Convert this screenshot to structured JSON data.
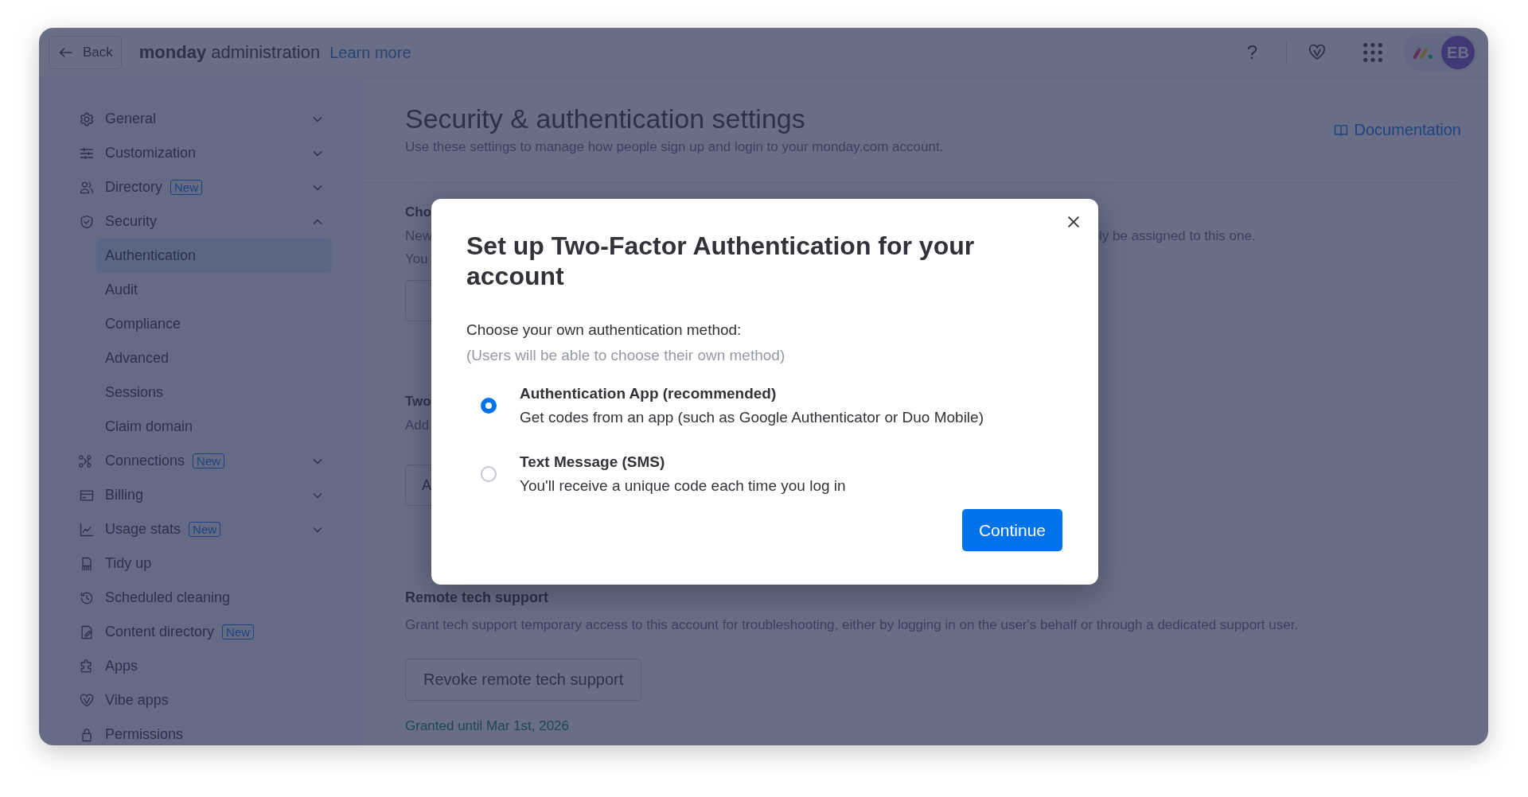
{
  "header": {
    "back_label": "Back",
    "title": "**monday** administration",
    "learn_more": "Learn more",
    "help": "?",
    "avatar_initials": "EB"
  },
  "sidebar": {
    "items": [
      {
        "label": "General",
        "expanded": false,
        "selected": false
      },
      {
        "label": "Customization",
        "expanded": false,
        "selected": false
      },
      {
        "label": "Directory",
        "badge": "New",
        "expanded": false,
        "selected": false
      },
      {
        "label": "Security",
        "expanded": true,
        "selected": false,
        "children": [
          {
            "label": "Authentication",
            "selected": true
          },
          {
            "label": "Audit",
            "selected": false
          },
          {
            "label": "Compliance",
            "selected": false
          },
          {
            "label": "Advanced",
            "selected": false
          },
          {
            "label": "Sessions",
            "selected": false
          },
          {
            "label": "Claim domain",
            "selected": false
          }
        ]
      },
      {
        "label": "Connections",
        "badge": "New",
        "expanded": false,
        "selected": false
      },
      {
        "label": "Billing",
        "expanded": false,
        "selected": false
      },
      {
        "label": "Usage stats",
        "badge": "New",
        "expanded": false,
        "selected": false
      },
      {
        "label": "Tidy up",
        "selected": false
      },
      {
        "label": "Scheduled cleaning",
        "selected": false
      },
      {
        "label": "Content directory",
        "badge": "New",
        "selected": false
      },
      {
        "label": "Apps",
        "selected": false
      },
      {
        "label": "Vibe apps",
        "selected": false
      },
      {
        "label": "Permissions",
        "selected": false
      }
    ]
  },
  "page": {
    "title": "Security & authentication settings",
    "subtitle": "Use these settings to manage how people sign up and login to your monday.com account.",
    "documentation_link": "Documentation",
    "sections": [
      {
        "title": "Cho",
        "lines": [
          {
            "text": "New",
            "trailing": "ly be assigned to this one."
          },
          {
            "text": "You"
          }
        ],
        "has_button": true
      },
      {
        "title": "Two",
        "lines": [
          {
            "text": "Add"
          }
        ],
        "has_button": true,
        "button_label": "A"
      }
    ],
    "remote_support": {
      "title": "Remote tech support",
      "description": "Grant tech support temporary access to this account for troubleshooting, either by logging in on the user's behalf or through a dedicated support user.",
      "button": "Revoke remote tech support",
      "granted": "Granted until Mar 1st, 2026"
    }
  },
  "modal": {
    "title": "Set up Two-Factor Authentication for your account",
    "prompt": "Choose your own authentication method:",
    "hint": "(Users will be able to choose their own method)",
    "options": [
      {
        "title": "Authentication App (recommended)",
        "description": "Get codes from an app (such as Google Authenticator or Duo Mobile)",
        "selected": true
      },
      {
        "title": "Text Message (SMS)",
        "description": "You'll receive a unique code each time you log in",
        "selected": false
      }
    ],
    "continue_button": "Continue"
  }
}
